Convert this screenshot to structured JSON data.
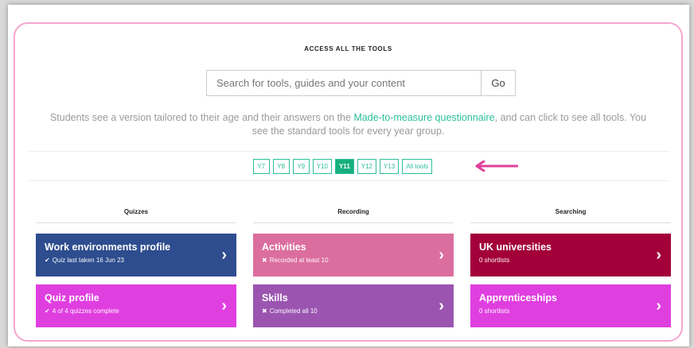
{
  "heading": "ACCESS ALL THE TOOLS",
  "search": {
    "placeholder": "Search for tools, guides and your content",
    "go_label": "Go"
  },
  "description": {
    "before": "Students see a version tailored to their age and their answers on the ",
    "link": "Made-to-measure questionnaire",
    "after": ", and can click to see all tools. You see the standard tools for every year group."
  },
  "year_filters": [
    {
      "label": "Y7",
      "active": false
    },
    {
      "label": "Y8",
      "active": false
    },
    {
      "label": "Y9",
      "active": false
    },
    {
      "label": "Y10",
      "active": false
    },
    {
      "label": "Y11",
      "active": true
    },
    {
      "label": "Y12",
      "active": false
    },
    {
      "label": "Y13",
      "active": false
    },
    {
      "label": "All tools",
      "active": false
    }
  ],
  "colors": {
    "accent": "#2bbf9a",
    "active_year": "#16b07e",
    "arrow": "#e0409b",
    "panel_border": "#f4a6cf"
  },
  "columns": [
    {
      "header": "Quizzes",
      "cards": [
        {
          "title": "Work environments profile",
          "mark": "✔",
          "subtitle": "Quiz last taken 16 Jun 23",
          "color": "#2e4d8f"
        },
        {
          "title": "Quiz profile",
          "mark": "✔",
          "subtitle": "4 of 4 quizzes complete",
          "color": "#e03fe0"
        }
      ]
    },
    {
      "header": "Recording",
      "cards": [
        {
          "title": "Activities",
          "mark": "✖",
          "subtitle": "Recorded at least 10",
          "color": "#db6e9e"
        },
        {
          "title": "Skills",
          "mark": "✖",
          "subtitle": "Completed all 10",
          "color": "#9b55b0"
        }
      ]
    },
    {
      "header": "Searching",
      "cards": [
        {
          "title": "UK universities",
          "mark": "",
          "subtitle": "0 shortlists",
          "color": "#a3003a"
        },
        {
          "title": "Apprenticeships",
          "mark": "",
          "subtitle": "0 shortlists",
          "color": "#e03fe0"
        }
      ]
    }
  ]
}
